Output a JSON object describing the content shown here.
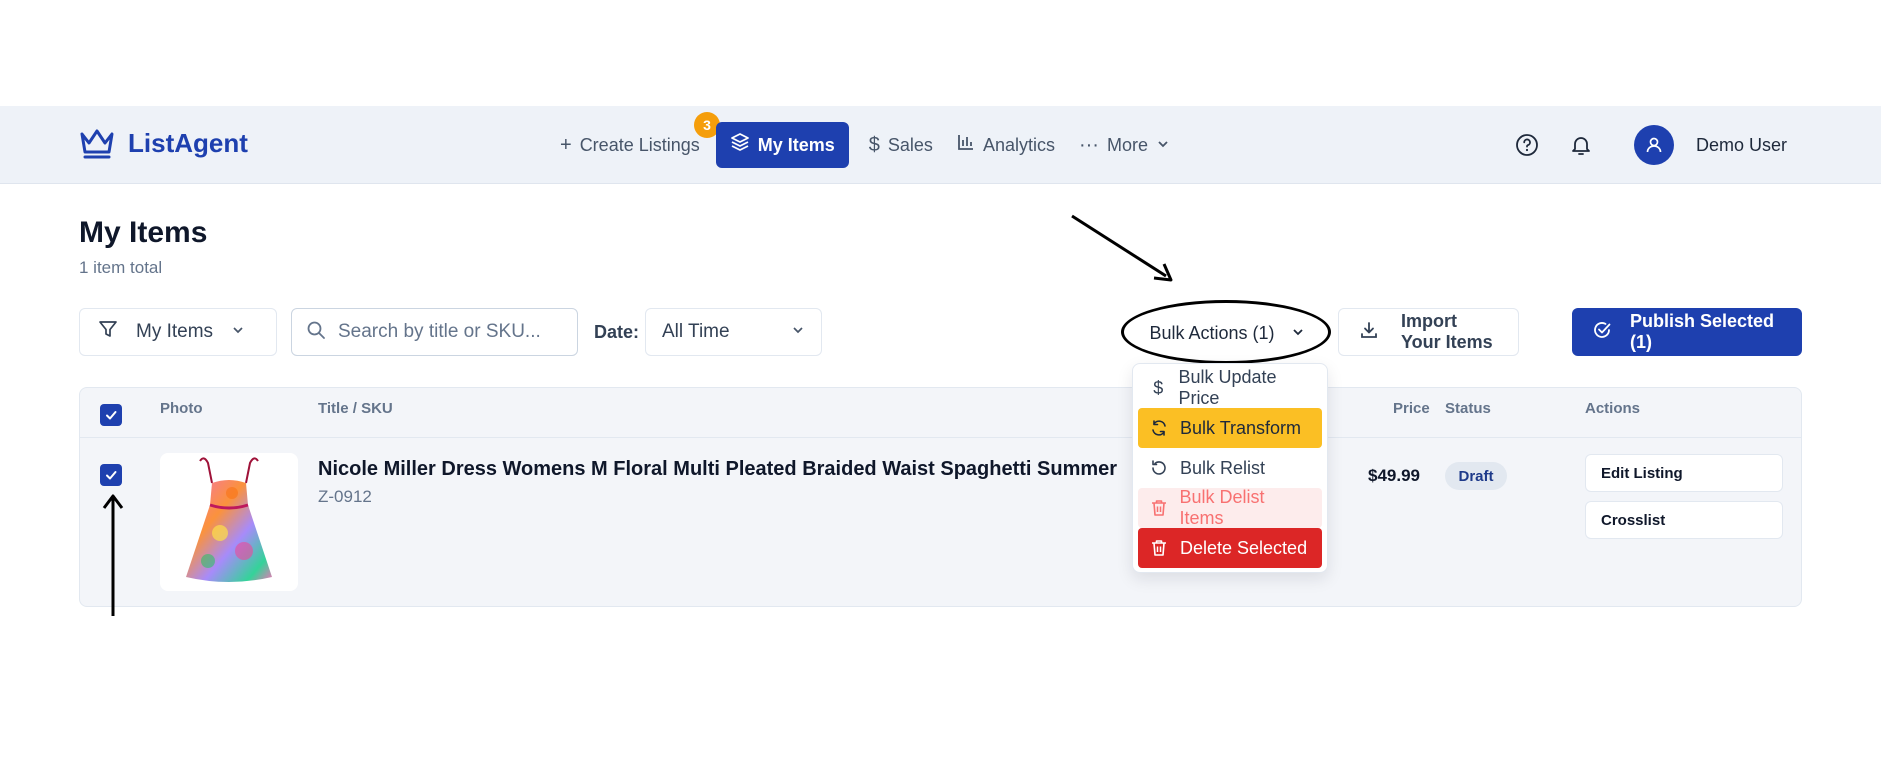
{
  "brand": {
    "name": "ListAgent"
  },
  "nav": {
    "items": [
      {
        "label": "Create Listings",
        "icon": "plus-icon",
        "badge": "3"
      },
      {
        "label": "My Items",
        "icon": "layers-icon",
        "active": true
      },
      {
        "label": "Sales",
        "icon": "dollar-icon"
      },
      {
        "label": "Analytics",
        "icon": "bar-chart-icon"
      },
      {
        "label": "More",
        "icon": "more-dots-icon"
      }
    ]
  },
  "user": {
    "name": "Demo User"
  },
  "page": {
    "title": "My Items",
    "subtitle": "1 item total"
  },
  "toolbar": {
    "filter_value": "My Items",
    "search_placeholder": "Search by title or SKU...",
    "date_label": "Date:",
    "date_value": "All Time",
    "bulk_label": "Bulk Actions (1)",
    "import_label": "Import Your Items",
    "publish_label": "Publish Selected (1)"
  },
  "bulk_menu": {
    "items": [
      {
        "label": "Bulk Update Price",
        "icon": "dollar-icon"
      },
      {
        "label": "Bulk Transform",
        "icon": "refresh-icon"
      },
      {
        "label": "Bulk Relist",
        "icon": "rotate-ccw-icon"
      },
      {
        "label": "Bulk Delist Items",
        "icon": "trash-icon"
      },
      {
        "label": "Delete Selected",
        "icon": "trash-icon"
      }
    ]
  },
  "table": {
    "headers": {
      "photo": "Photo",
      "title": "Title / SKU",
      "price": "Price",
      "status": "Status",
      "actions": "Actions"
    },
    "rows": [
      {
        "title": "Nicole Miller Dress Womens M Floral Multi Pleated Braided Waist Spaghetti Summer",
        "sku": "Z-0912",
        "price": "$49.99",
        "status": "Draft",
        "actions": [
          "Edit Listing",
          "Crosslist"
        ]
      }
    ]
  },
  "colors": {
    "primary": "#1e40af",
    "badge": "#f59e0b",
    "highlight": "#fbbf24",
    "danger": "#dc2626"
  }
}
